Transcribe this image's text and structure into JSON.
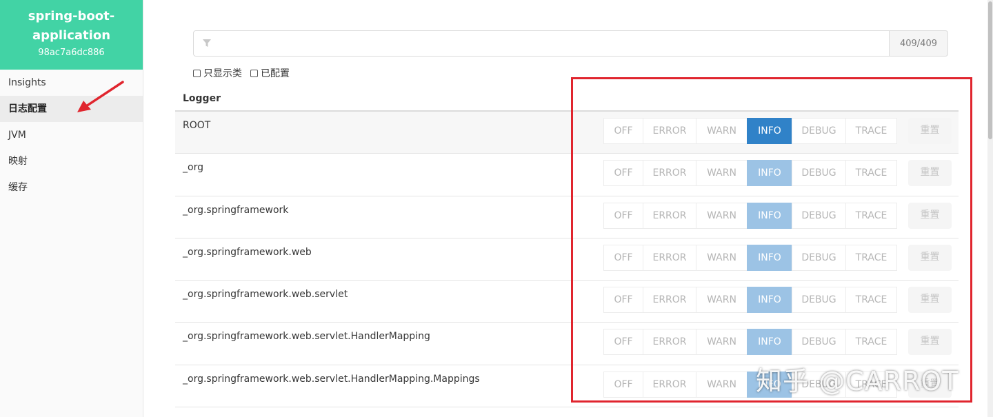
{
  "app": {
    "name": "spring-boot-application",
    "id": "98ac7a6dc886"
  },
  "sidebar": {
    "items": [
      {
        "label": "Insights"
      },
      {
        "label": "日志配置"
      },
      {
        "label": "JVM"
      },
      {
        "label": "映射"
      },
      {
        "label": "缓存"
      }
    ],
    "active_index": 1
  },
  "filter": {
    "placeholder": "",
    "value": "",
    "count": "409/409",
    "icon": "filter-icon"
  },
  "options": {
    "only_classes": "只显示类",
    "configured": "已配置"
  },
  "table": {
    "header": "Logger",
    "levels": [
      "OFF",
      "ERROR",
      "WARN",
      "INFO",
      "DEBUG",
      "TRACE"
    ],
    "reset_label": "重置",
    "rows": [
      {
        "name": "ROOT",
        "level": "INFO"
      },
      {
        "name": "_org",
        "level": "INFO"
      },
      {
        "name": "_org.springframework",
        "level": "INFO"
      },
      {
        "name": "_org.springframework.web",
        "level": "INFO"
      },
      {
        "name": "_org.springframework.web.servlet",
        "level": "INFO"
      },
      {
        "name": "_org.springframework.web.servlet.HandlerMapping",
        "level": "INFO"
      },
      {
        "name": "_org.springframework.web.servlet.HandlerMapping.Mappings",
        "level": "INFO"
      }
    ]
  },
  "annotations": {
    "highlight_color": "#e0252e",
    "watermark": "知乎 @CARROT"
  },
  "colors": {
    "brand": "#42d3a5",
    "info_active": "#3082c8",
    "info_inherited": "#9cc3e5"
  }
}
